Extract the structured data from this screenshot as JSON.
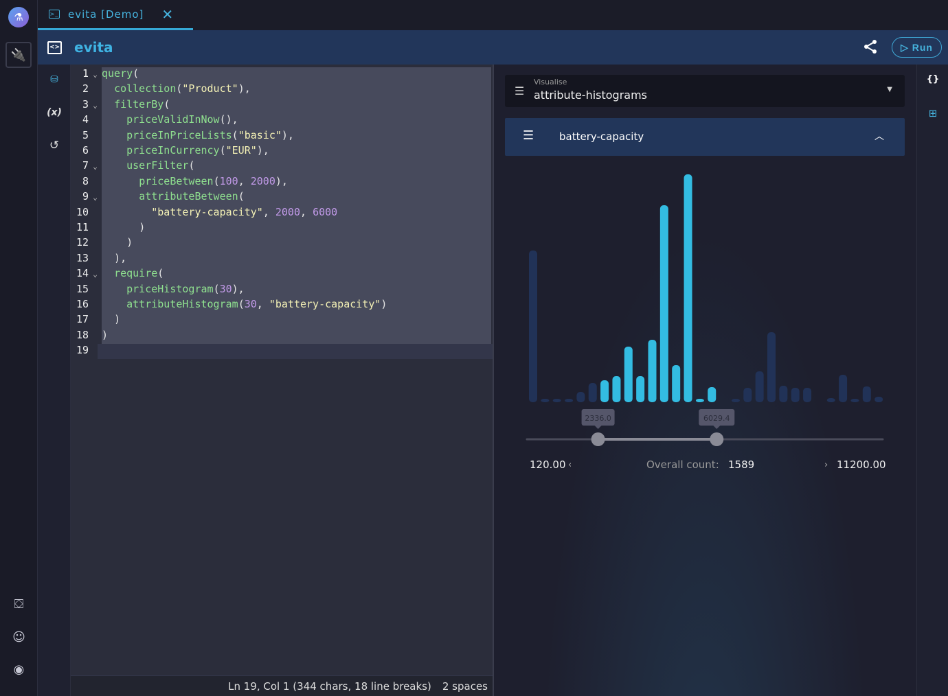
{
  "tab": {
    "title": "evita [Demo]",
    "close": "✕"
  },
  "header": {
    "title": "evita",
    "run_label": "▷ Run"
  },
  "left_rail": {
    "icons": [
      "lab-logo",
      "plug",
      "inbox",
      "discord",
      "github"
    ]
  },
  "editor_rail": {
    "variables_label": "(x)"
  },
  "editor": {
    "lines": [
      {
        "n": "1",
        "fold": true,
        "indent": 0,
        "tokens": [
          [
            "fn",
            "query"
          ],
          [
            "punc",
            "("
          ]
        ]
      },
      {
        "n": "2",
        "fold": false,
        "indent": 1,
        "tokens": [
          [
            "fn",
            "collection"
          ],
          [
            "punc",
            "("
          ],
          [
            "str",
            "\"Product\""
          ],
          [
            "punc",
            "),"
          ]
        ]
      },
      {
        "n": "3",
        "fold": true,
        "indent": 1,
        "tokens": [
          [
            "fn",
            "filterBy"
          ],
          [
            "punc",
            "("
          ]
        ]
      },
      {
        "n": "4",
        "fold": false,
        "indent": 2,
        "tokens": [
          [
            "fn",
            "priceValidInNow"
          ],
          [
            "punc",
            "(),"
          ]
        ]
      },
      {
        "n": "5",
        "fold": false,
        "indent": 2,
        "tokens": [
          [
            "fn",
            "priceInPriceLists"
          ],
          [
            "punc",
            "("
          ],
          [
            "str",
            "\"basic\""
          ],
          [
            "punc",
            "),"
          ]
        ]
      },
      {
        "n": "6",
        "fold": false,
        "indent": 2,
        "tokens": [
          [
            "fn",
            "priceInCurrency"
          ],
          [
            "punc",
            "("
          ],
          [
            "str",
            "\"EUR\""
          ],
          [
            "punc",
            "),"
          ]
        ]
      },
      {
        "n": "7",
        "fold": true,
        "indent": 2,
        "tokens": [
          [
            "fn",
            "userFilter"
          ],
          [
            "punc",
            "("
          ]
        ]
      },
      {
        "n": "8",
        "fold": false,
        "indent": 3,
        "tokens": [
          [
            "fn",
            "priceBetween"
          ],
          [
            "punc",
            "("
          ],
          [
            "num",
            "100"
          ],
          [
            "punc",
            ", "
          ],
          [
            "num",
            "2000"
          ],
          [
            "punc",
            "),"
          ]
        ]
      },
      {
        "n": "9",
        "fold": true,
        "indent": 3,
        "tokens": [
          [
            "fn",
            "attributeBetween"
          ],
          [
            "punc",
            "("
          ]
        ]
      },
      {
        "n": "10",
        "fold": false,
        "indent": 4,
        "tokens": [
          [
            "str",
            "\"battery-capacity\""
          ],
          [
            "punc",
            ", "
          ],
          [
            "num",
            "2000"
          ],
          [
            "punc",
            ", "
          ],
          [
            "num",
            "6000"
          ]
        ]
      },
      {
        "n": "11",
        "fold": false,
        "indent": 3,
        "tokens": [
          [
            "punc",
            ")"
          ]
        ]
      },
      {
        "n": "12",
        "fold": false,
        "indent": 2,
        "tokens": [
          [
            "punc",
            ")"
          ]
        ]
      },
      {
        "n": "13",
        "fold": false,
        "indent": 1,
        "tokens": [
          [
            "punc",
            "),"
          ]
        ]
      },
      {
        "n": "14",
        "fold": true,
        "indent": 1,
        "tokens": [
          [
            "fn",
            "require"
          ],
          [
            "punc",
            "("
          ]
        ]
      },
      {
        "n": "15",
        "fold": false,
        "indent": 2,
        "tokens": [
          [
            "fn",
            "priceHistogram"
          ],
          [
            "punc",
            "("
          ],
          [
            "num",
            "30"
          ],
          [
            "punc",
            "),"
          ]
        ]
      },
      {
        "n": "16",
        "fold": false,
        "indent": 2,
        "tokens": [
          [
            "fn",
            "attributeHistogram"
          ],
          [
            "punc",
            "("
          ],
          [
            "num",
            "30"
          ],
          [
            "punc",
            ", "
          ],
          [
            "str",
            "\"battery-capacity\""
          ],
          [
            "punc",
            ")"
          ]
        ]
      },
      {
        "n": "17",
        "fold": false,
        "indent": 1,
        "tokens": [
          [
            "punc",
            ")"
          ]
        ]
      },
      {
        "n": "18",
        "fold": false,
        "indent": 0,
        "tokens": [
          [
            "punc",
            ")"
          ]
        ]
      },
      {
        "n": "19",
        "fold": false,
        "indent": 0,
        "tokens": []
      }
    ],
    "status": {
      "position": "Ln 19, Col 1 (344 chars, 18 line breaks)",
      "indent": "2 spaces"
    }
  },
  "visualise": {
    "label": "Visualise",
    "value": "attribute-histograms"
  },
  "histogram": {
    "title": "battery-capacity",
    "min_label": "120.00",
    "max_label": "11200.00",
    "count_label": "Overall count:",
    "count": "1589",
    "from_label": "2336.0",
    "to_label": "6029.4"
  },
  "right_rail": {
    "json_label": "{}"
  },
  "colors": {
    "active": "#33bce2",
    "inactive": "#213257"
  },
  "chart_data": {
    "type": "bar",
    "title": "battery-capacity",
    "min": 120,
    "max": 11200,
    "selected_range": [
      2336.0,
      6029.4
    ],
    "values": [
      219,
      3,
      2,
      2,
      13,
      26,
      30,
      36,
      79,
      36,
      89,
      285,
      52,
      330,
      1,
      20,
      0,
      3,
      19,
      43,
      100,
      22,
      19,
      19,
      0,
      4,
      38,
      1,
      21,
      6
    ],
    "selected": [
      false,
      false,
      false,
      false,
      false,
      false,
      true,
      true,
      true,
      true,
      true,
      true,
      true,
      true,
      true,
      true,
      false,
      false,
      false,
      false,
      false,
      false,
      false,
      false,
      false,
      false,
      false,
      false,
      false,
      false
    ]
  }
}
